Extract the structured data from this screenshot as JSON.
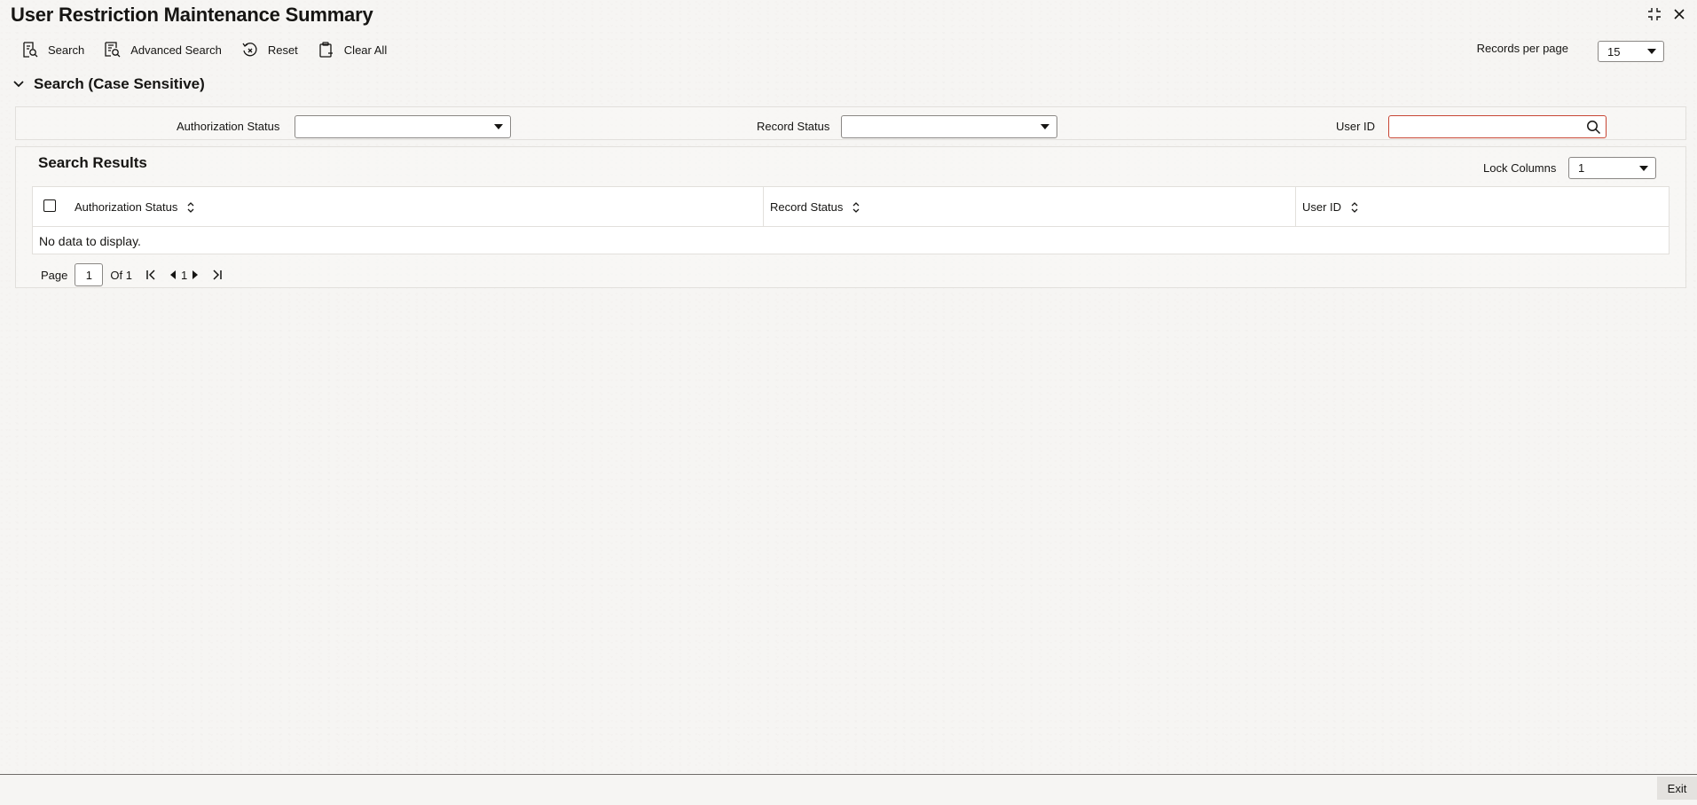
{
  "window": {
    "title": "User Restriction Maintenance Summary",
    "icons": [
      "collapse-icon",
      "close-icon"
    ]
  },
  "toolbar": {
    "search_label": "Search",
    "advanced_search_label": "Advanced Search",
    "reset_label": "Reset",
    "clear_all_label": "Clear All"
  },
  "records_per_page": {
    "label": "Records per page",
    "value": "15"
  },
  "search_section": {
    "title": "Search (Case Sensitive)",
    "fields": {
      "authorization_status": {
        "label": "Authorization Status",
        "value": ""
      },
      "record_status": {
        "label": "Record Status",
        "value": ""
      },
      "user_id": {
        "label": "User ID",
        "value": ""
      }
    }
  },
  "results": {
    "title": "Search Results",
    "lock_columns": {
      "label": "Lock Columns",
      "value": "1"
    },
    "columns": [
      "Authorization Status",
      "Record Status",
      "User ID"
    ],
    "rows": [],
    "empty_text": "No data to display."
  },
  "pagination": {
    "page_label": "Page",
    "current_page": "1",
    "of_label": "Of 1",
    "nav_page": "1"
  },
  "footer": {
    "exit_label": "Exit"
  },
  "colors": {
    "error_border": "#c74634",
    "text": "#161513",
    "border": "#e2e0dc"
  }
}
